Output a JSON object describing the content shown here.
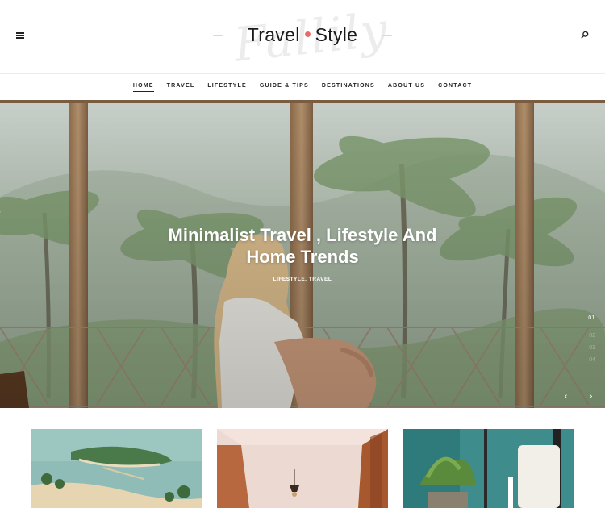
{
  "header": {
    "logo_main_left": "Travel",
    "logo_main_right": "Style",
    "logo_script": "Fallily",
    "menu_icon": "hamburger-icon",
    "search_icon": "search-icon"
  },
  "nav": {
    "items": [
      {
        "label": "HOME",
        "active": true
      },
      {
        "label": "TRAVEL",
        "active": false
      },
      {
        "label": "LIFESTYLE",
        "active": false
      },
      {
        "label": "GUIDE & TIPS",
        "active": false
      },
      {
        "label": "DESTINATIONS",
        "active": false
      },
      {
        "label": "ABOUT US",
        "active": false
      },
      {
        "label": "CONTACT",
        "active": false
      }
    ]
  },
  "hero": {
    "title_line1": "Minimalist Travel , Lifestyle And",
    "title_line2": "Home Trends",
    "categories": "LIFESTYLE, TRAVEL",
    "slide_current": "01",
    "slide_others": [
      "02",
      "03",
      "04"
    ],
    "prev_icon": "chevron-left-icon",
    "next_icon": "chevron-right-icon"
  },
  "cards": [
    {
      "image": "tropical-island-aerial"
    },
    {
      "image": "interior-ceiling-lamp"
    },
    {
      "image": "plant-and-candle"
    }
  ],
  "colors": {
    "accent": "#e86a6a",
    "text": "#222222"
  }
}
